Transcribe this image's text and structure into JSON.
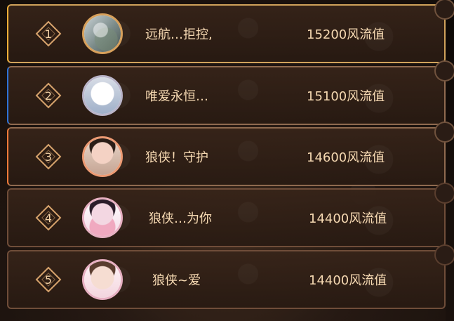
{
  "leaderboard": {
    "entries": [
      {
        "rank": "1",
        "name": "远航…拒控,",
        "score": "15200风流值"
      },
      {
        "rank": "2",
        "name": "唯爱永恒…",
        "score": "15100风流值"
      },
      {
        "rank": "3",
        "name": "狼侠！守护",
        "score": "14600风流值"
      },
      {
        "rank": "4",
        "name": "狼侠…为你",
        "score": "14400风流值"
      },
      {
        "rank": "5",
        "name": "狼侠~爱",
        "score": "14400风流值"
      }
    ]
  },
  "colors": {
    "rank1_accent": "#f2b039",
    "rank2_accent": "#2e73d8",
    "rank3_accent": "#f07a3a",
    "text": "#f6d9b2",
    "frame": "#8f6a4f"
  }
}
